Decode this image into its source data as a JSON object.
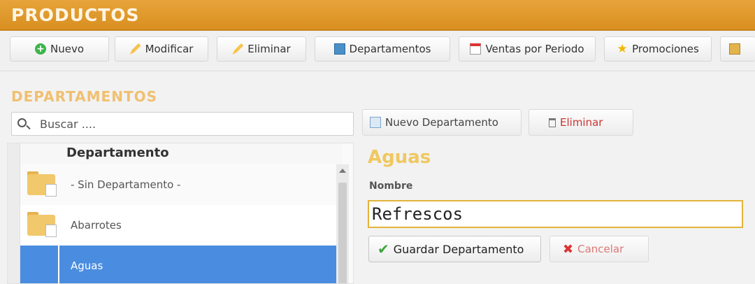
{
  "header": {
    "title": "PRODUCTOS"
  },
  "toolbar": {
    "nuevo": {
      "label": "Nuevo",
      "icon": "plus-icon"
    },
    "modificar": {
      "label": "Modificar",
      "icon": "pencil-icon"
    },
    "eliminar": {
      "label": "Eliminar",
      "icon": "pencil-delete-icon"
    },
    "departamentos": {
      "label": "Departamentos",
      "icon": "departments-icon"
    },
    "ventas": {
      "label": "Ventas por Periodo",
      "icon": "calendar-icon"
    },
    "promociones": {
      "label": "Promociones",
      "icon": "star-icon"
    }
  },
  "section": {
    "title": "DEPARTAMENTOS"
  },
  "search": {
    "placeholder": "Buscar ...."
  },
  "list": {
    "column_header": "Departamento",
    "items": [
      {
        "label": "- Sin Departamento -"
      },
      {
        "label": "Abarrotes"
      },
      {
        "label": "Aguas",
        "selected": true
      }
    ]
  },
  "detail": {
    "new_button": "Nuevo Departamento",
    "delete_button": "Eliminar",
    "title": "Aguas",
    "name_label": "Nombre",
    "name_value": "Refrescos",
    "save_button": "Guardar Departamento",
    "cancel_button": "Cancelar"
  },
  "colors": {
    "header": "#d98f20",
    "selection": "#4a8de0",
    "accent_text": "#f0c860",
    "input_border": "#e2b43a"
  }
}
